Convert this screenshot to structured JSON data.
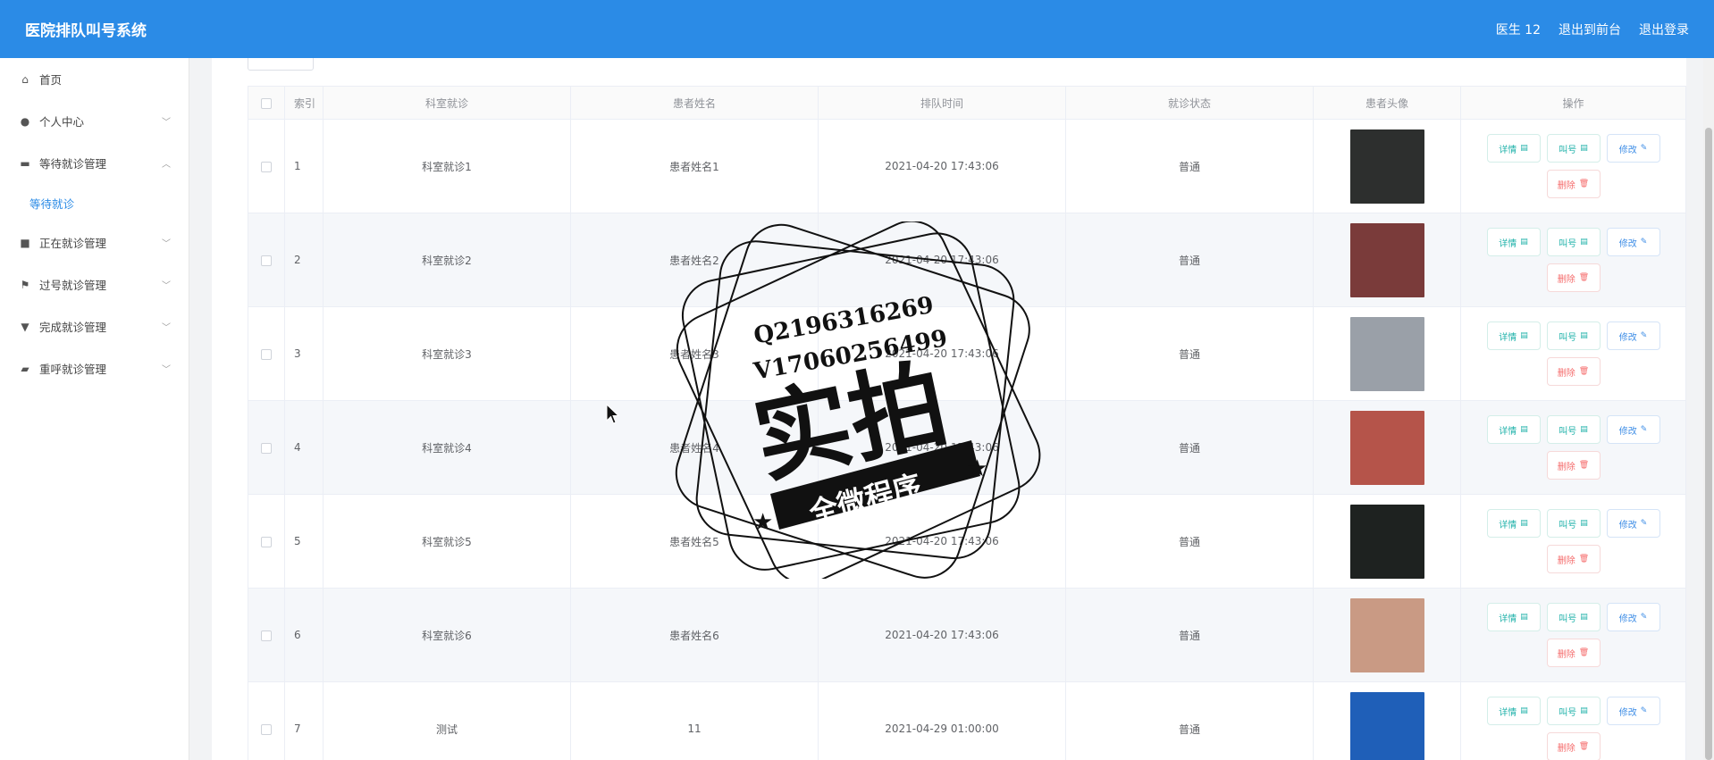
{
  "app": {
    "title": "医院排队叫号系统"
  },
  "header": {
    "user": "医生 12",
    "front": "退出到前台",
    "logout": "退出登录"
  },
  "sidebar": {
    "items": [
      {
        "label": "首页",
        "icon": "home-icon",
        "glyph": "⌂"
      },
      {
        "label": "个人中心",
        "icon": "user-icon",
        "glyph": "●"
      },
      {
        "label": "等待就诊管理",
        "icon": "chat-icon",
        "glyph": "▬",
        "expanded": true
      },
      {
        "label": "正在就诊管理",
        "icon": "printer-icon",
        "glyph": "■"
      },
      {
        "label": "过号就诊管理",
        "icon": "flag-icon",
        "glyph": "⚑"
      },
      {
        "label": "完成就诊管理",
        "icon": "stamp-icon",
        "glyph": "▼"
      },
      {
        "label": "重呼就诊管理",
        "icon": "briefcase-icon",
        "glyph": "▰"
      }
    ],
    "sub_item": "等待就诊"
  },
  "table": {
    "headers": [
      "索引",
      "科室就诊",
      "患者姓名",
      "排队时间",
      "就诊状态",
      "患者头像",
      "操作"
    ],
    "rows": [
      {
        "idx": "1",
        "dept": "科室就诊1",
        "name": "患者姓名1",
        "time": "2021-04-20 17:43:06",
        "status": "普通",
        "avatar_color": "#2d2f2e"
      },
      {
        "idx": "2",
        "dept": "科室就诊2",
        "name": "患者姓名2",
        "time": "2021-04-20 17:43:06",
        "status": "普通",
        "avatar_color": "#7a3b3a"
      },
      {
        "idx": "3",
        "dept": "科室就诊3",
        "name": "患者姓名3",
        "time": "2021-04-20 17:43:06",
        "status": "普通",
        "avatar_color": "#9aa0a8"
      },
      {
        "idx": "4",
        "dept": "科室就诊4",
        "name": "患者姓名4",
        "time": "2021-04-20 17:43:06",
        "status": "普通",
        "avatar_color": "#b5544a"
      },
      {
        "idx": "5",
        "dept": "科室就诊5",
        "name": "患者姓名5",
        "time": "2021-04-20 17:43:06",
        "status": "普通",
        "avatar_color": "#1e2220"
      },
      {
        "idx": "6",
        "dept": "科室就诊6",
        "name": "患者姓名6",
        "time": "2021-04-20 17:43:06",
        "status": "普通",
        "avatar_color": "#c99a84"
      },
      {
        "idx": "7",
        "dept": "测试",
        "name": "11",
        "time": "2021-04-29 01:00:00",
        "status": "普通",
        "avatar_color": "#1f5fb8"
      }
    ],
    "actions": {
      "detail": "详情",
      "call": "叫号",
      "edit": "修改",
      "delete": "删除"
    }
  },
  "watermark": {
    "line1": "Q2196316269",
    "line2": "V17060256499",
    "main": "实拍",
    "banner": "全微程序"
  },
  "colors": {
    "header": "#2b8be6",
    "teal": "#20b2aa",
    "blue": "#3f8ee6",
    "red": "#f56c6c"
  }
}
